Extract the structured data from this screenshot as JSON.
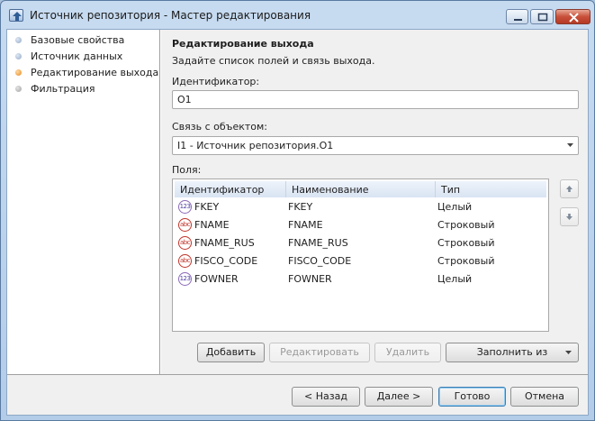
{
  "window": {
    "title": "Источник репозитория - Мастер редактирования"
  },
  "nav": {
    "items": [
      {
        "label": "Базовые свойства",
        "state": "done"
      },
      {
        "label": "Источник данных",
        "state": "done"
      },
      {
        "label": "Редактирование выхода",
        "state": "active"
      },
      {
        "label": "Фильтрация",
        "state": "pending"
      }
    ]
  },
  "page": {
    "heading": "Редактирование выхода",
    "subtitle": "Задайте список полей и связь выхода.",
    "identifier_label": "Идентификатор:",
    "identifier_value": "O1",
    "link_label": "Связь с объектом:",
    "link_value": "I1 - Источник репозитория.O1",
    "fields_label": "Поля:",
    "grid": {
      "columns": [
        "Идентификатор",
        "Наименование",
        "Тип"
      ],
      "rows": [
        {
          "id": "FKEY",
          "name": "FKEY",
          "type": "Целый",
          "icon": "123"
        },
        {
          "id": "FNAME",
          "name": "FNAME",
          "type": "Строковый",
          "icon": "abc"
        },
        {
          "id": "FNAME_RUS",
          "name": "FNAME_RUS",
          "type": "Строковый",
          "icon": "abc"
        },
        {
          "id": "FISCO_CODE",
          "name": "FISCO_CODE",
          "type": "Строковый",
          "icon": "abc"
        },
        {
          "id": "FOWNER",
          "name": "FOWNER",
          "type": "Целый",
          "icon": "123"
        }
      ]
    },
    "buttons": {
      "add": "Добавить",
      "edit": "Редактировать",
      "delete": "Удалить",
      "fill": "Заполнить из"
    }
  },
  "footer": {
    "back": "< Назад",
    "next": "Далее >",
    "finish": "Готово",
    "cancel": "Отмена"
  },
  "icons": {
    "app": "upload-arrow-icon",
    "move_up": "arrow-up-icon",
    "move_down": "arrow-down-icon"
  },
  "colors": {
    "active_step": "#e78a1e",
    "close_button": "#c8503a",
    "grid_header": "#d9e4f3"
  }
}
